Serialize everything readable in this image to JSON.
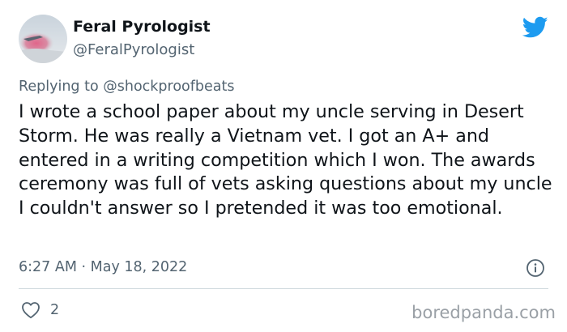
{
  "tweet": {
    "display_name": "Feral Pyrologist",
    "handle": "@FeralPyrologist",
    "replying_prefix": "Replying to",
    "replying_to": "@shockproofbeats",
    "text": "I wrote a school paper about my uncle serving in Desert Storm.  He was really a Vietnam vet. I got an A+ and entered in a writing competition which I won.  The awards ceremony was full of vets asking questions about my uncle I couldn't answer so I pretended it was too emotional.",
    "timestamp": "6:27 AM · May 18, 2022",
    "like_count": "2"
  },
  "icons": {
    "brand": "twitter-bird-icon",
    "info": "info-icon",
    "like": "heart-icon"
  },
  "colors": {
    "twitter_blue": "#1d9bf0",
    "secondary_text": "#536471",
    "primary_text": "#0f1419",
    "divider": "#cfd9de",
    "watermark": "#9aa0a6"
  },
  "watermark": "boredpanda.com"
}
